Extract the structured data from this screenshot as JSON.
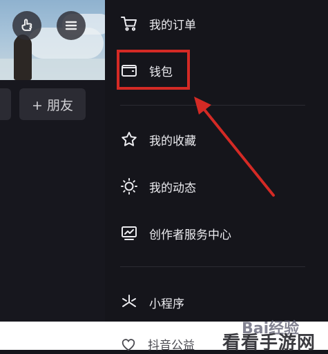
{
  "left": {
    "add_friend_label": "+ 朋友",
    "icons": {
      "left_button": "hand-pointer-icon",
      "right_button": "hamburger-menu-icon"
    }
  },
  "menu": {
    "items": [
      {
        "label": "我的订单",
        "icon": "cart-icon"
      },
      {
        "label": "钱包",
        "icon": "wallet-icon"
      },
      {
        "label": "我的收藏",
        "icon": "star-icon"
      },
      {
        "label": "我的动态",
        "icon": "activity-icon"
      },
      {
        "label": "创作者服务中心",
        "icon": "creator-center-icon"
      },
      {
        "label": "小程序",
        "icon": "mini-program-icon"
      },
      {
        "label": "抖音公益",
        "icon": "heart-icon"
      }
    ]
  },
  "annotation": {
    "color": "#d42a25"
  },
  "watermarks": {
    "baidu": "Bai经验",
    "site": "看看手游网"
  }
}
